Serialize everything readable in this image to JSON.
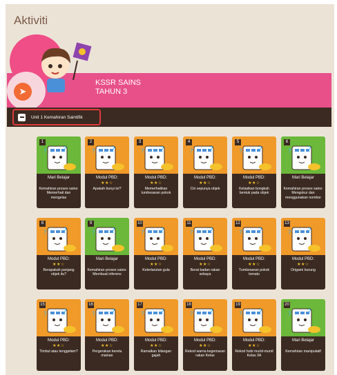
{
  "page": {
    "title": "Aktiviti"
  },
  "banner": {
    "subject": "KSSR SAINS",
    "level": "TAHUN 3"
  },
  "unit": {
    "label": "Unit 1 Kemahiran Saintifik"
  },
  "colors": {
    "accent_pink": "#e8508a",
    "dark_bar": "#3b2a21",
    "orange": "#f09a2a",
    "green": "#6bb83a",
    "highlight": "#e03a3a"
  },
  "activities": [
    {
      "num": "1",
      "type": "Mari Belajar",
      "stars": "",
      "desc": "Kemahiran proses sains: Memerhati dan mengelas",
      "color": "green"
    },
    {
      "num": "2",
      "type": "Modul PBD:",
      "stars": "★★☆",
      "desc": "Apakah bunyi ini?",
      "color": "orange"
    },
    {
      "num": "3",
      "type": "Modul PBD:",
      "stars": "★★☆",
      "desc": "Memerhatikan tumbesaran pokok",
      "color": "orange"
    },
    {
      "num": "4",
      "type": "Modul PBD:",
      "stars": "★★☆",
      "desc": "Ciri sepunya objek",
      "color": "orange"
    },
    {
      "num": "5",
      "type": "Modul PBD:",
      "stars": "★★☆",
      "desc": "Kelasikan bongkah bentuk pada objek",
      "color": "orange"
    },
    {
      "num": "6",
      "type": "Mari Belajar",
      "stars": "",
      "desc": "Kemahiran proses sains: Mengukur dan menggunakan nombor",
      "color": "green"
    },
    {
      "num": "8",
      "type": "Modul PBD:",
      "stars": "★★☆",
      "desc": "Berapakah panjang objek itu?",
      "color": "orange"
    },
    {
      "num": "9",
      "type": "Mari Belajar",
      "stars": "",
      "desc": "Kemahiran proses sains: Membuat inferens",
      "color": "green"
    },
    {
      "num": "10",
      "type": "Modul PBD:",
      "stars": "★★☆",
      "desc": "Keterlarutan gula",
      "color": "orange"
    },
    {
      "num": "11",
      "type": "Modul PBD:",
      "stars": "★★☆",
      "desc": "Berat badan rakan sebaya",
      "color": "orange"
    },
    {
      "num": "12",
      "type": "Modul PBD:",
      "stars": "★★☆",
      "desc": "Tumbesaran pokok tomato",
      "color": "orange"
    },
    {
      "num": "13",
      "type": "Modul PBD:",
      "stars": "★★☆",
      "desc": "Origami burung",
      "color": "orange"
    },
    {
      "num": "15",
      "type": "Modul PBD:",
      "stars": "★★☆",
      "desc": "Timbul atau tenggelam?",
      "color": "orange"
    },
    {
      "num": "16",
      "type": "Modul PBD:",
      "stars": "★★☆",
      "desc": "Pergerakan kereta mainan",
      "color": "orange"
    },
    {
      "num": "17",
      "type": "Modul PBD:",
      "stars": "★★☆",
      "desc": "Ramalkan bilangan gajah",
      "color": "orange"
    },
    {
      "num": "18",
      "type": "Modul PBD:",
      "stars": "★★☆",
      "desc": "Rekod warna kegemaran rakan Kelas",
      "color": "orange"
    },
    {
      "num": "19",
      "type": "Modul PBD:",
      "stars": "★★☆",
      "desc": "Rekod hobi murid-murid Kelas 3A",
      "color": "orange"
    },
    {
      "num": "20",
      "type": "Mari Belajar",
      "stars": "",
      "desc": "Kemahiran manipulatif",
      "color": "green"
    }
  ]
}
